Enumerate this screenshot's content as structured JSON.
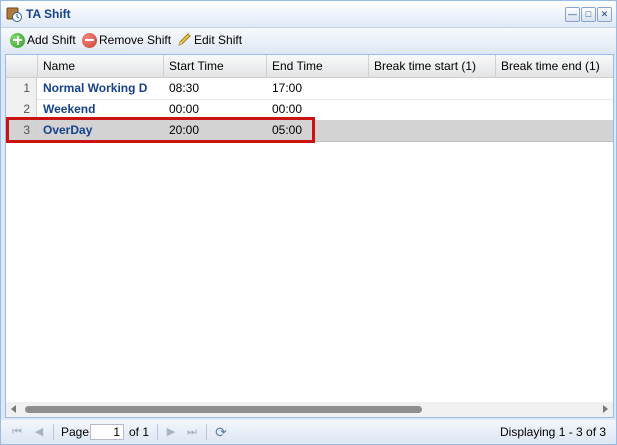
{
  "window": {
    "title": "TA Shift"
  },
  "toolbar": {
    "add_label": "Add Shift",
    "remove_label": "Remove Shift",
    "edit_label": "Edit Shift"
  },
  "grid": {
    "columns": [
      "Name",
      "Start Time",
      "End Time",
      "Break time start (1)",
      "Break time end (1)"
    ],
    "rows": [
      {
        "num": "1",
        "name": "Normal Working D",
        "start": "08:30",
        "end": "17:00"
      },
      {
        "num": "2",
        "name": "Weekend",
        "start": "00:00",
        "end": "00:00"
      },
      {
        "num": "3",
        "name": "OverDay",
        "start": "20:00",
        "end": "05:00"
      }
    ]
  },
  "pager": {
    "page_label": "Page",
    "page_value": "1",
    "of_label": "of 1",
    "display_text": "Displaying 1 - 3 of 3"
  },
  "colors": {
    "highlight": "#cc1111",
    "name_text": "#15428b"
  }
}
